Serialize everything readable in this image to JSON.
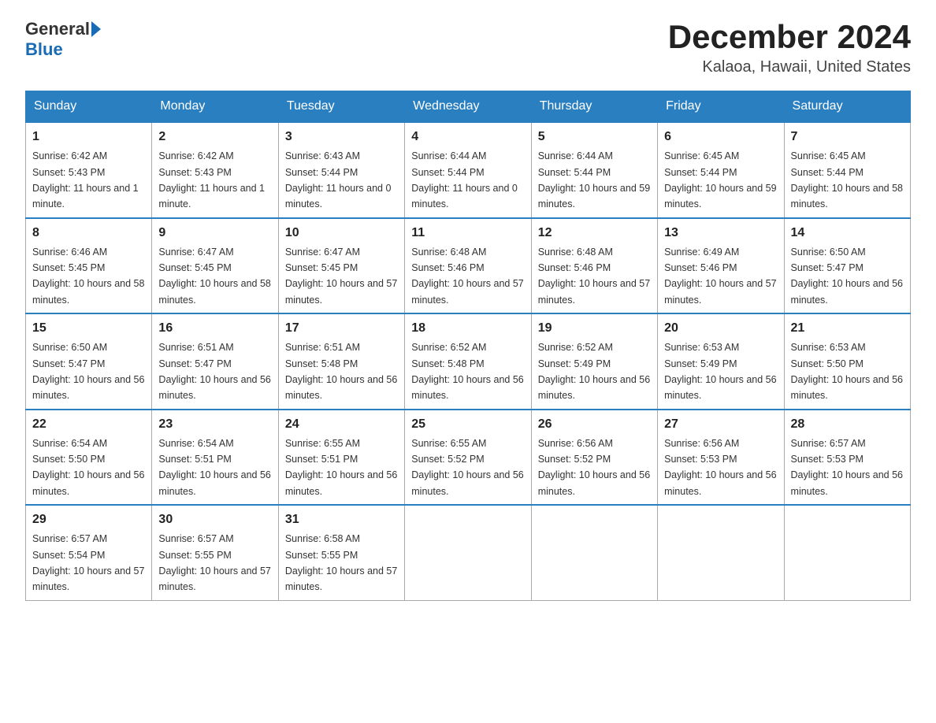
{
  "header": {
    "logo_general": "General",
    "logo_blue": "Blue",
    "month_title": "December 2024",
    "location": "Kalaoa, Hawaii, United States"
  },
  "days_of_week": [
    "Sunday",
    "Monday",
    "Tuesday",
    "Wednesday",
    "Thursday",
    "Friday",
    "Saturday"
  ],
  "weeks": [
    [
      {
        "day": "1",
        "sunrise": "6:42 AM",
        "sunset": "5:43 PM",
        "daylight": "11 hours and 1 minute."
      },
      {
        "day": "2",
        "sunrise": "6:42 AM",
        "sunset": "5:43 PM",
        "daylight": "11 hours and 1 minute."
      },
      {
        "day": "3",
        "sunrise": "6:43 AM",
        "sunset": "5:44 PM",
        "daylight": "11 hours and 0 minutes."
      },
      {
        "day": "4",
        "sunrise": "6:44 AM",
        "sunset": "5:44 PM",
        "daylight": "11 hours and 0 minutes."
      },
      {
        "day": "5",
        "sunrise": "6:44 AM",
        "sunset": "5:44 PM",
        "daylight": "10 hours and 59 minutes."
      },
      {
        "day": "6",
        "sunrise": "6:45 AM",
        "sunset": "5:44 PM",
        "daylight": "10 hours and 59 minutes."
      },
      {
        "day": "7",
        "sunrise": "6:45 AM",
        "sunset": "5:44 PM",
        "daylight": "10 hours and 58 minutes."
      }
    ],
    [
      {
        "day": "8",
        "sunrise": "6:46 AM",
        "sunset": "5:45 PM",
        "daylight": "10 hours and 58 minutes."
      },
      {
        "day": "9",
        "sunrise": "6:47 AM",
        "sunset": "5:45 PM",
        "daylight": "10 hours and 58 minutes."
      },
      {
        "day": "10",
        "sunrise": "6:47 AM",
        "sunset": "5:45 PM",
        "daylight": "10 hours and 57 minutes."
      },
      {
        "day": "11",
        "sunrise": "6:48 AM",
        "sunset": "5:46 PM",
        "daylight": "10 hours and 57 minutes."
      },
      {
        "day": "12",
        "sunrise": "6:48 AM",
        "sunset": "5:46 PM",
        "daylight": "10 hours and 57 minutes."
      },
      {
        "day": "13",
        "sunrise": "6:49 AM",
        "sunset": "5:46 PM",
        "daylight": "10 hours and 57 minutes."
      },
      {
        "day": "14",
        "sunrise": "6:50 AM",
        "sunset": "5:47 PM",
        "daylight": "10 hours and 56 minutes."
      }
    ],
    [
      {
        "day": "15",
        "sunrise": "6:50 AM",
        "sunset": "5:47 PM",
        "daylight": "10 hours and 56 minutes."
      },
      {
        "day": "16",
        "sunrise": "6:51 AM",
        "sunset": "5:47 PM",
        "daylight": "10 hours and 56 minutes."
      },
      {
        "day": "17",
        "sunrise": "6:51 AM",
        "sunset": "5:48 PM",
        "daylight": "10 hours and 56 minutes."
      },
      {
        "day": "18",
        "sunrise": "6:52 AM",
        "sunset": "5:48 PM",
        "daylight": "10 hours and 56 minutes."
      },
      {
        "day": "19",
        "sunrise": "6:52 AM",
        "sunset": "5:49 PM",
        "daylight": "10 hours and 56 minutes."
      },
      {
        "day": "20",
        "sunrise": "6:53 AM",
        "sunset": "5:49 PM",
        "daylight": "10 hours and 56 minutes."
      },
      {
        "day": "21",
        "sunrise": "6:53 AM",
        "sunset": "5:50 PM",
        "daylight": "10 hours and 56 minutes."
      }
    ],
    [
      {
        "day": "22",
        "sunrise": "6:54 AM",
        "sunset": "5:50 PM",
        "daylight": "10 hours and 56 minutes."
      },
      {
        "day": "23",
        "sunrise": "6:54 AM",
        "sunset": "5:51 PM",
        "daylight": "10 hours and 56 minutes."
      },
      {
        "day": "24",
        "sunrise": "6:55 AM",
        "sunset": "5:51 PM",
        "daylight": "10 hours and 56 minutes."
      },
      {
        "day": "25",
        "sunrise": "6:55 AM",
        "sunset": "5:52 PM",
        "daylight": "10 hours and 56 minutes."
      },
      {
        "day": "26",
        "sunrise": "6:56 AM",
        "sunset": "5:52 PM",
        "daylight": "10 hours and 56 minutes."
      },
      {
        "day": "27",
        "sunrise": "6:56 AM",
        "sunset": "5:53 PM",
        "daylight": "10 hours and 56 minutes."
      },
      {
        "day": "28",
        "sunrise": "6:57 AM",
        "sunset": "5:53 PM",
        "daylight": "10 hours and 56 minutes."
      }
    ],
    [
      {
        "day": "29",
        "sunrise": "6:57 AM",
        "sunset": "5:54 PM",
        "daylight": "10 hours and 57 minutes."
      },
      {
        "day": "30",
        "sunrise": "6:57 AM",
        "sunset": "5:55 PM",
        "daylight": "10 hours and 57 minutes."
      },
      {
        "day": "31",
        "sunrise": "6:58 AM",
        "sunset": "5:55 PM",
        "daylight": "10 hours and 57 minutes."
      },
      null,
      null,
      null,
      null
    ]
  ]
}
